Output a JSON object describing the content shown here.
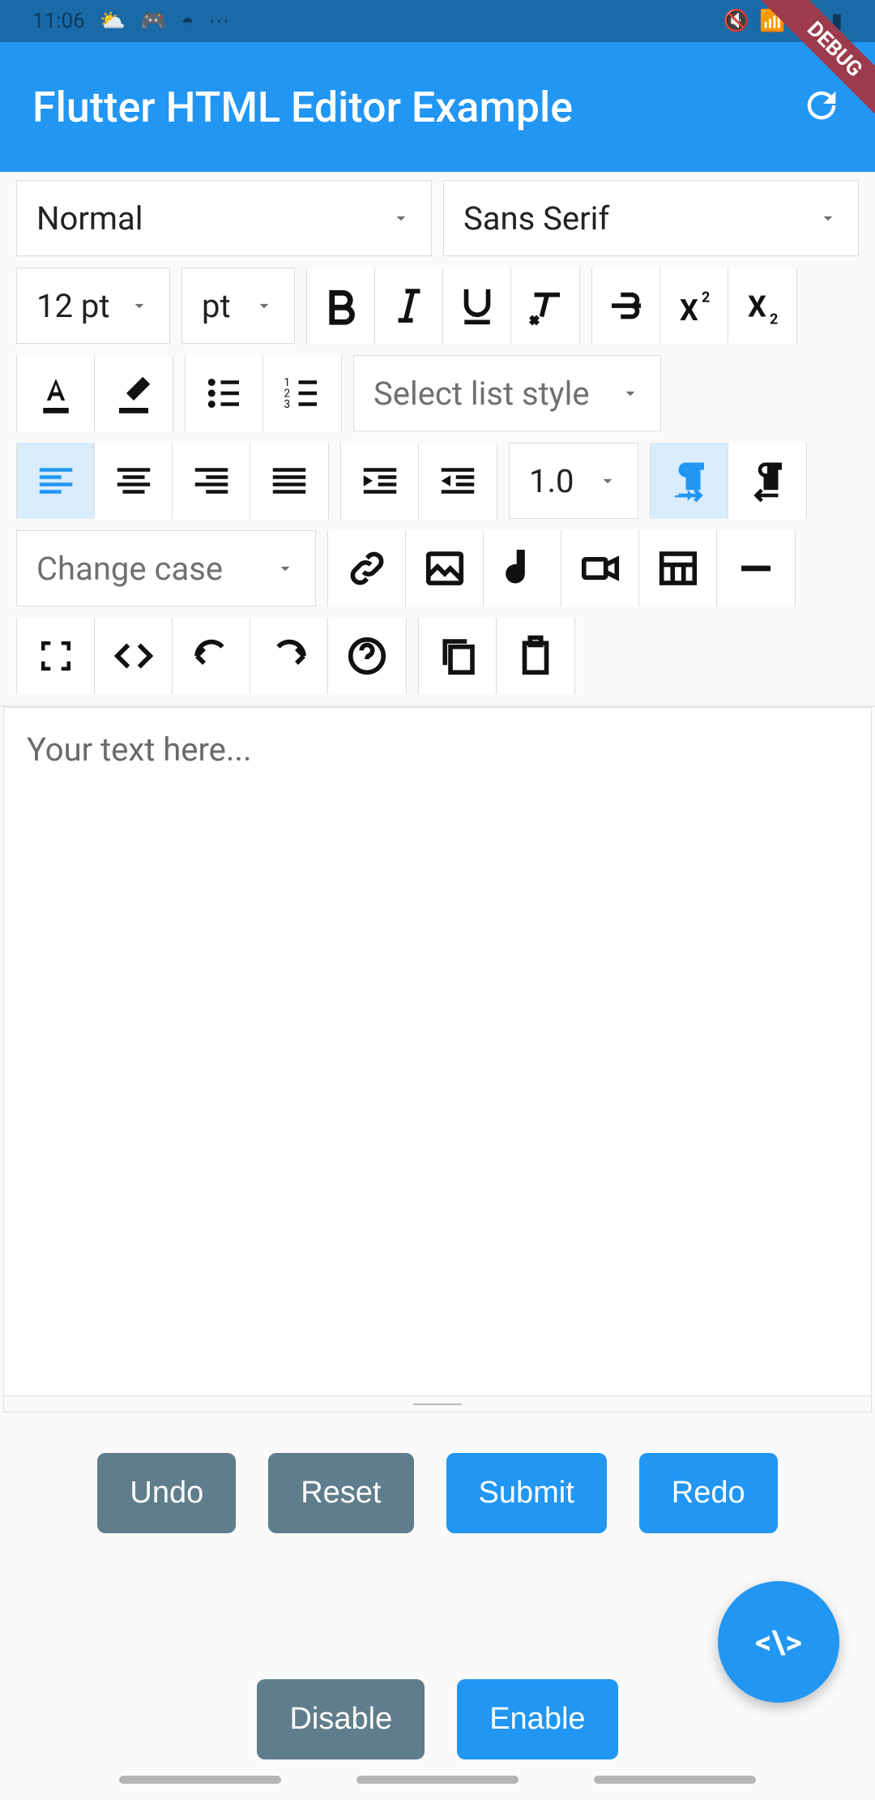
{
  "status": {
    "time": "11:06"
  },
  "app": {
    "title": "Flutter HTML Editor Example"
  },
  "toolbar": {
    "paragraph_style": "Normal",
    "font_family": "Sans Serif",
    "font_size": "12 pt",
    "font_unit": "pt",
    "list_style_placeholder": "Select list style",
    "line_height": "1.0",
    "change_case_placeholder": "Change case"
  },
  "editor": {
    "placeholder": "Your text here..."
  },
  "actions": {
    "undo": "Undo",
    "reset": "Reset",
    "submit": "Submit",
    "redo": "Redo",
    "disable": "Disable",
    "enable": "Enable"
  },
  "fab": {
    "label": "<\\>"
  },
  "debug_banner": "DEBUG"
}
